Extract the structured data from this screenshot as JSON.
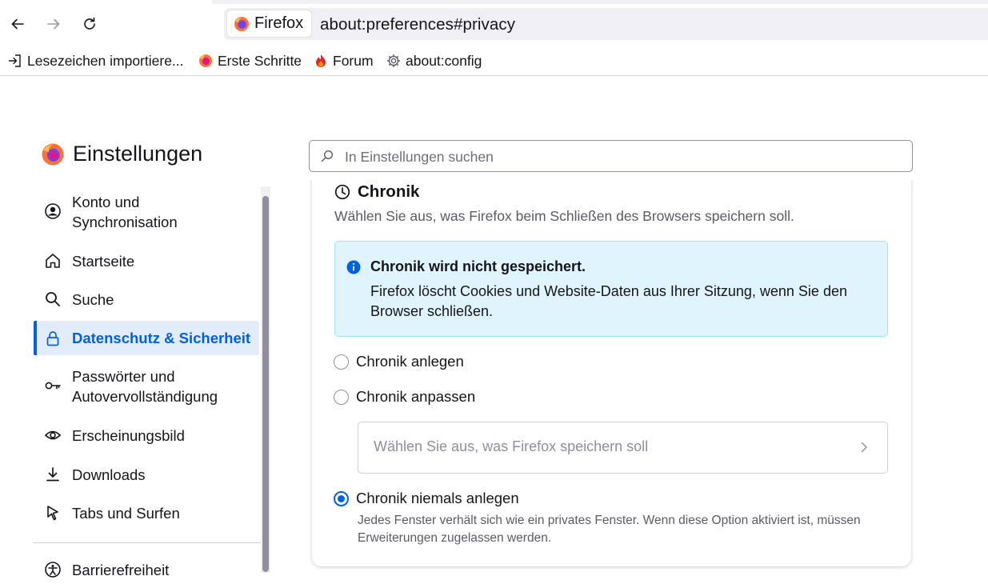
{
  "browser": {
    "identity_label": "Firefox",
    "url": "about:preferences#privacy"
  },
  "bookmarks": [
    {
      "label": "Lesezeichen importiere...",
      "icon": "import-icon"
    },
    {
      "label": "Erste Schritte",
      "icon": "firefox-logo-icon"
    },
    {
      "label": "Forum",
      "icon": "flame-icon"
    },
    {
      "label": "about:config",
      "icon": "gear-icon"
    }
  ],
  "settings": {
    "title": "Einstellungen",
    "search_placeholder": "In Einstellungen suchen"
  },
  "sidebar": {
    "items": [
      {
        "label": "Konto und\nSynchronisation",
        "icon": "account-icon"
      },
      {
        "label": "Startseite",
        "icon": "home-icon"
      },
      {
        "label": "Suche",
        "icon": "search-icon"
      },
      {
        "label": "Datenschutz & Sicherheit",
        "icon": "lock-icon",
        "selected": true
      },
      {
        "label": "Passwörter und\nAutovervollständigung",
        "icon": "key-icon"
      },
      {
        "label": "Erscheinungsbild",
        "icon": "eye-icon"
      },
      {
        "label": "Downloads",
        "icon": "download-icon"
      },
      {
        "label": "Tabs und Surfen",
        "icon": "cursor-icon"
      },
      {
        "label": "Barrierefreiheit",
        "icon": "accessibility-icon"
      }
    ]
  },
  "history": {
    "title": "Chronik",
    "description": "Wählen Sie aus, was Firefox beim Schließen des Browsers speichern soll.",
    "info_title": "Chronik wird nicht gespeichert.",
    "info_text": "Firefox löscht Cookies und Website-Daten aus Ihrer Sitzung, wenn Sie den Browser schließen.",
    "options": [
      {
        "label": "Chronik anlegen",
        "checked": false
      },
      {
        "label": "Chronik anpassen",
        "checked": false
      },
      {
        "label": "Chronik niemals anlegen",
        "checked": true
      }
    ],
    "custom_select_label": "Wählen Sie aus, was Firefox speichern soll",
    "never_description": "Jedes Fenster verhält sich wie ein privates Fenster. Wenn diese Option aktiviert ist, müssen Erweiterungen zugelassen werden."
  },
  "colors": {
    "accent": "#0061e0",
    "selected_bg": "#e2ecfb",
    "info_bg": "#e0f4fd"
  }
}
